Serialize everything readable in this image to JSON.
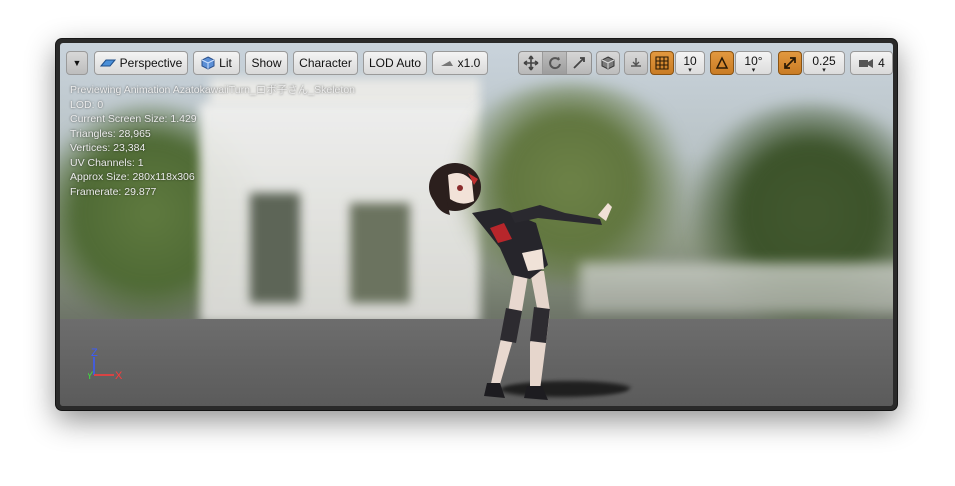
{
  "toolbar": {
    "options_dropdown": "▼",
    "perspective_label": "Perspective",
    "lit_label": "Lit",
    "show_label": "Show",
    "character_label": "Character",
    "lod_label": "LOD Auto",
    "speed_label": "x1.0",
    "grid_snap_value": "10",
    "rotation_snap_value": "10°",
    "scale_snap_value": "0.25",
    "camera_speed_value": "4",
    "accent_color": "#d88a30"
  },
  "stats": {
    "previewing": "Previewing Animation AzatokawaiiTurn_ロボ子さん_Skeleton",
    "lod": "LOD: 0",
    "screen_size": "Current Screen Size: 1.429",
    "triangles": "Triangles: 28,965",
    "vertices": "Vertices: 23,384",
    "uv_channels": "UV Channels: 1",
    "approx_size": "Approx Size: 280x118x306",
    "framerate": "Framerate: 29.877"
  },
  "axes": {
    "z": "Z",
    "y": "Y",
    "x": "X"
  }
}
